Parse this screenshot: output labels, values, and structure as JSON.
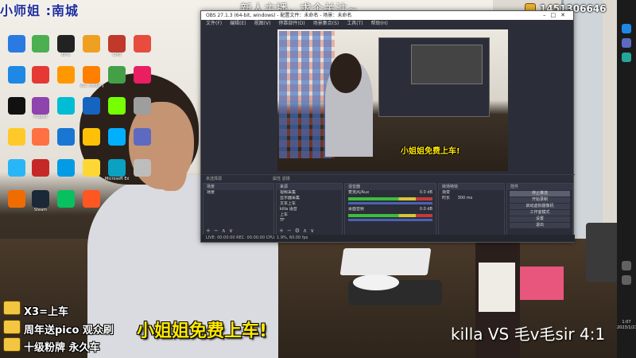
{
  "overlay": {
    "top_left_banner": "小师姐 :南城",
    "top_mid_banner": "新人主播，求个关注~",
    "streamer_id": "1451306646",
    "promo_text": "小姐姐免费上车!",
    "score_text": "killa VS 毛v毛sir 4:1",
    "side_lines": [
      "X3=上车",
      "周年送pico 观众刷",
      "十级粉牌 永久车"
    ]
  },
  "desktop": {
    "icons": [
      {
        "label": "",
        "color": "#2a7ae2"
      },
      {
        "label": "",
        "color": "#4caf50"
      },
      {
        "label": "EPIC",
        "color": "#222222"
      },
      {
        "label": "",
        "color": "#f0a020"
      },
      {
        "label": "CMS",
        "color": "#c0392b"
      },
      {
        "label": "",
        "color": "#e74c3c"
      },
      {
        "label": "",
        "color": "#1e88e5"
      },
      {
        "label": "",
        "color": "#e53935"
      },
      {
        "label": "",
        "color": "#ff9800"
      },
      {
        "label": "VLC media player",
        "color": "#ff7f00"
      },
      {
        "label": "",
        "color": "#43a047"
      },
      {
        "label": "",
        "color": "#e91e63"
      },
      {
        "label": "",
        "color": "#111111"
      },
      {
        "label": "Project",
        "color": "#8e44ad"
      },
      {
        "label": "",
        "color": "#00bcd4"
      },
      {
        "label": "",
        "color": "#1565c0"
      },
      {
        "label": "",
        "color": "#76ff03"
      },
      {
        "label": "",
        "color": "#9e9e9e"
      },
      {
        "label": "",
        "color": "#ffca28"
      },
      {
        "label": "",
        "color": "#ff7043"
      },
      {
        "label": "",
        "color": "#1976d2"
      },
      {
        "label": "",
        "color": "#ffc107"
      },
      {
        "label": "",
        "color": "#00b0ff"
      },
      {
        "label": "",
        "color": "#5c6bc0"
      },
      {
        "label": "",
        "color": "#29b6f6"
      },
      {
        "label": "",
        "color": "#c62828"
      },
      {
        "label": "",
        "color": "#039be5"
      },
      {
        "label": "",
        "color": "#fdd835"
      },
      {
        "label": "Microsoft Edge",
        "color": "#0aa1c2"
      },
      {
        "label": "",
        "color": "#bdbdbd"
      },
      {
        "label": "",
        "color": "#ef6c00"
      },
      {
        "label": "Steam",
        "color": "#1b2838"
      },
      {
        "label": "",
        "color": "#07c160"
      },
      {
        "label": "",
        "color": "#ff5722"
      }
    ]
  },
  "obs": {
    "title": "OBS 27.1.3 (64-bit, windows) - 配置文件：未命名 - 场景：未命名",
    "menu": [
      "文件(F)",
      "编辑(E)",
      "视图(V)",
      "停靠部件(D)",
      "场景集合(S)",
      "工具(T)",
      "帮助(H)"
    ],
    "ctrl_left": "未选择源",
    "ctrl_mid": "属性   滤镜",
    "docks": {
      "scenes": {
        "header": "场景",
        "items": [
          "场景"
        ]
      },
      "sources": {
        "header": "来源",
        "items": [
          "视频采集",
          "显示器采集",
          "文本上车",
          "killa 语音",
          "上车",
          "TF"
        ]
      },
      "mixer": {
        "header": "混音器",
        "tracks": [
          "麦克风/Aux",
          "桌面音频"
        ],
        "levels": [
          "0.0 dB",
          "0.0 dB"
        ]
      },
      "transitions": {
        "header": "转场特效",
        "type": "渐变",
        "duration_label": "时长",
        "duration": "300 ms"
      },
      "controls": {
        "header": "控件",
        "buttons": [
          "停止推流",
          "开始录制",
          "启动虚拟摄像机",
          "工作室模式",
          "设置",
          "退出"
        ]
      }
    },
    "status": "LIVE: 00:00:00   REC: 00:00:00   CPU: 1.9%, 60.00 fps"
  },
  "taskbar": {
    "clock_time": "1:07",
    "clock_date": "2023/1/21"
  }
}
